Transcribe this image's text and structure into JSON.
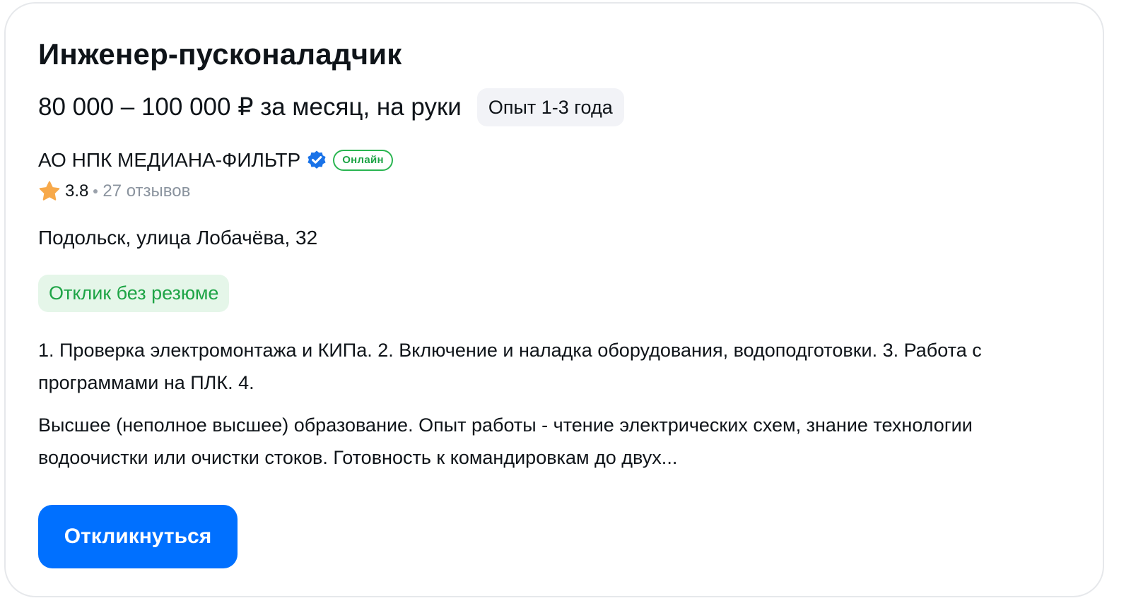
{
  "vacancy": {
    "title": "Инженер-пусконаладчик",
    "salary": "80 000 – 100 000 ₽ за месяц, на руки",
    "experience_badge": "Опыт 1-3 года",
    "company": {
      "name": "АО НПК МЕДИАНА-ФИЛЬТР",
      "verified_icon": "verified-check-icon",
      "online_badge": "Онлайн",
      "rating": "3.8",
      "reviews": "27 отзывов"
    },
    "address": "Подольск, улица Лобачёва, 32",
    "no_resume_badge": "Отклик без резюме",
    "responsibilities": "1. Проверка электромонтажа и КИПа. 2. Включение и наладка оборудования, водоподготовки. 3. Работа с программами на ПЛК. 4.",
    "requirements": "Высшее (неполное высшее) образование. Опыт работы - чтение электрических схем, знание технологии водоочистки или очистки стоков. Готовность к командировкам до двух...",
    "respond_button": "Откликнуться"
  },
  "colors": {
    "accent": "#0070ff",
    "green": "#1ea446",
    "green_bg": "#e5f6e9",
    "star": "#f7a94a",
    "verified": "#1a73e8"
  }
}
